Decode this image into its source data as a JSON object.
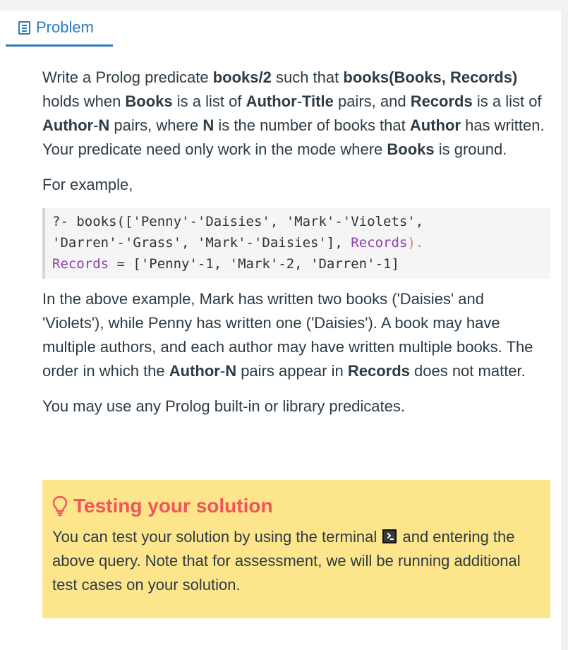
{
  "tab": {
    "label": "Problem",
    "icon": "document-icon"
  },
  "intro": {
    "t1": "Write a Prolog predicate ",
    "b1": "books/2",
    "t2": " such that ",
    "b2": "books(Books, Records)",
    "t3": " holds when ",
    "b3": "Books",
    "t4": " is a list of ",
    "b4": "Author",
    "t5": "-",
    "b5": "Title",
    "t6": " pairs, and ",
    "b6": "Records",
    "t7": " is a list of ",
    "b7": "Author",
    "t8": "-",
    "b8": "N",
    "t9": " pairs, where ",
    "b9": "N",
    "t10": " is the number of books that ",
    "b10": "Author",
    "t11": " has written. Your predicate need only work in the mode where ",
    "b11": "Books",
    "t12": " is ground."
  },
  "example_label": "For example,",
  "code": {
    "line1": "?- books(['Penny'-'Daisies', 'Mark'-'Violets',",
    "line2_a": "'Darren'-'Grass', 'Mark'-'Daisies'], ",
    "line2_var": "Records",
    "line2_end": ").",
    "line3_var": "Records",
    "line3_rest": " = ['Penny'-1, 'Mark'-2, 'Darren'-1]"
  },
  "explain": {
    "t1": "In the above example, Mark has written two books ('Daisies' and 'Violets'), while Penny has written one ('Daisies'). A book may have multiple authors, and each author may have written multiple books. The order in which the ",
    "b1": "Author",
    "t2": "-",
    "b2": "N",
    "t3": " pairs appear in ",
    "b3": "Records",
    "t4": " does not matter."
  },
  "builtin_note": "You may use any Prolog built-in or library predicates.",
  "tip": {
    "title": "Testing your solution",
    "icon": "lightbulb-icon",
    "body_a": "You can test your solution by using the terminal",
    "body_b": " and entering the above query. Note that for assessment, we will be running additional test cases on your solution."
  },
  "colors": {
    "accent": "#2b7abc",
    "tip_bg": "#fde58b",
    "tip_title": "#f2545b",
    "code_var": "#8e44ad"
  }
}
